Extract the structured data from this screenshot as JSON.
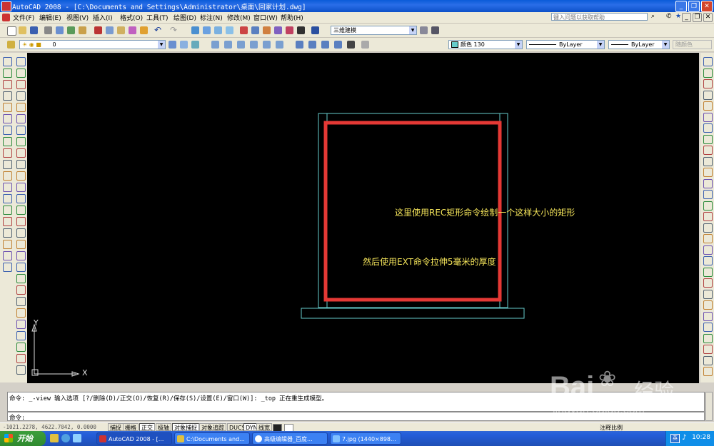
{
  "window": {
    "title": "AutoCAD 2008 - [C:\\Documents and Settings\\Administrator\\桌面\\回家计划.dwg]",
    "buttons": [
      "_",
      "❐",
      "✕"
    ],
    "doc_buttons": [
      "_",
      "❐",
      "✕"
    ]
  },
  "menu": {
    "items": [
      "文件(F)",
      "编辑(E)",
      "视图(V)",
      "插入(I)",
      "格式(O)",
      "工具(T)",
      "绘图(D)",
      "标注(N)",
      "修改(M)",
      "窗口(W)",
      "帮助(H)"
    ],
    "help_search_placeholder": "键入问题以获取帮助"
  },
  "toolbar": {
    "workspace": "三维建模",
    "layer": "0",
    "color": "颜色 130",
    "linetype": "ByLayer",
    "lineweight": "ByLayer",
    "plotstyle": "随颜色"
  },
  "canvas": {
    "annotation1": "这里使用REC矩形命令绘制一个这样大小的矩形",
    "annotation2": "然后使用EXT命令拉伸5毫米的厚度",
    "ucs_x": "X",
    "ucs_y": "Y",
    "colors": {
      "background": "#000000",
      "outline": "#66cccc",
      "highlight": "#e53935",
      "annotation": "#f5e55a"
    }
  },
  "command": {
    "history": "命令: _-view 输入选项 [?/删除(D)/正交(O)/恢复(R)/保存(S)/设置(E)/窗口(W)]: _top 正在重生成模型。",
    "prompt": "命令:"
  },
  "status": {
    "coords": "-1021.2278, 4622.7042, 0.0000",
    "toggles": [
      "捕捉",
      "栅格",
      "正交",
      "极轴",
      "对象捕捉",
      "对象追踪",
      "DUCS",
      "DYN",
      "线宽"
    ],
    "right_text": "注释比例"
  },
  "taskbar": {
    "start": "开始",
    "tasks": [
      "AutoCAD 2008 - [...",
      "C:\\Documents and...",
      "高级编辑器_百度...",
      "7.jpg (1440×898..."
    ],
    "clock": "10:28",
    "ime": "英"
  },
  "watermark": {
    "brand": "Bai",
    "brand2": "经验",
    "url": "jingyan.baidu.com"
  }
}
